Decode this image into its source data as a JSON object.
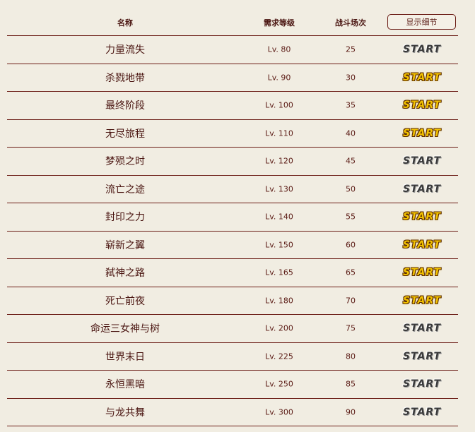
{
  "header": {
    "name": "名称",
    "level": "需求等级",
    "battles": "战斗场次",
    "detail_button": "显示细节"
  },
  "start_label": "START",
  "rows": [
    {
      "name": "力量流失",
      "level": "Lv. 80",
      "battles": "25",
      "start_active": false
    },
    {
      "name": "杀戮地带",
      "level": "Lv. 90",
      "battles": "30",
      "start_active": true
    },
    {
      "name": "最终阶段",
      "level": "Lv. 100",
      "battles": "35",
      "start_active": true
    },
    {
      "name": "无尽旅程",
      "level": "Lv. 110",
      "battles": "40",
      "start_active": true
    },
    {
      "name": "梦殒之时",
      "level": "Lv. 120",
      "battles": "45",
      "start_active": false
    },
    {
      "name": "流亡之途",
      "level": "Lv. 130",
      "battles": "50",
      "start_active": false
    },
    {
      "name": "封印之力",
      "level": "Lv. 140",
      "battles": "55",
      "start_active": true
    },
    {
      "name": "崭新之翼",
      "level": "Lv. 150",
      "battles": "60",
      "start_active": true
    },
    {
      "name": "弑神之路",
      "level": "Lv. 165",
      "battles": "65",
      "start_active": true
    },
    {
      "name": "死亡前夜",
      "level": "Lv. 180",
      "battles": "70",
      "start_active": true
    },
    {
      "name": "命运三女神与树",
      "level": "Lv. 200",
      "battles": "75",
      "start_active": false
    },
    {
      "name": "世界末日",
      "level": "Lv. 225",
      "battles": "80",
      "start_active": false
    },
    {
      "name": "永恒黑暗",
      "level": "Lv. 250",
      "battles": "85",
      "start_active": false
    },
    {
      "name": "与龙共舞",
      "level": "Lv. 300",
      "battles": "90",
      "start_active": false
    }
  ]
}
